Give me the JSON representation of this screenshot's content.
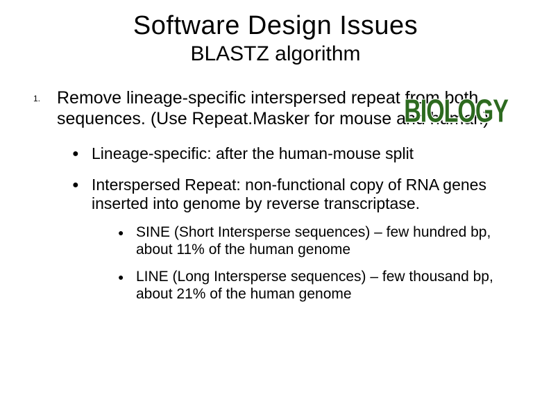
{
  "title": "Software Design Issues",
  "subtitle": "BLASTZ algorithm",
  "stamp": "BIOLOGY",
  "item1": {
    "number": "1.",
    "text": "Remove lineage-specific interspersed repeat from both sequences. (Use Repeat.Masker for mouse and human)",
    "sub": [
      {
        "text": "Lineage-specific: after the human-mouse split"
      },
      {
        "text": "Interspersed Repeat: non-functional copy of RNA genes inserted into genome by reverse transcriptase.",
        "sub": [
          {
            "text": "SINE (Short Intersperse sequences) – few hundred bp, about 11% of the human genome"
          },
          {
            "text": "LINE (Long Intersperse sequences) – few thousand bp, about 21% of the human genome"
          }
        ]
      }
    ]
  }
}
